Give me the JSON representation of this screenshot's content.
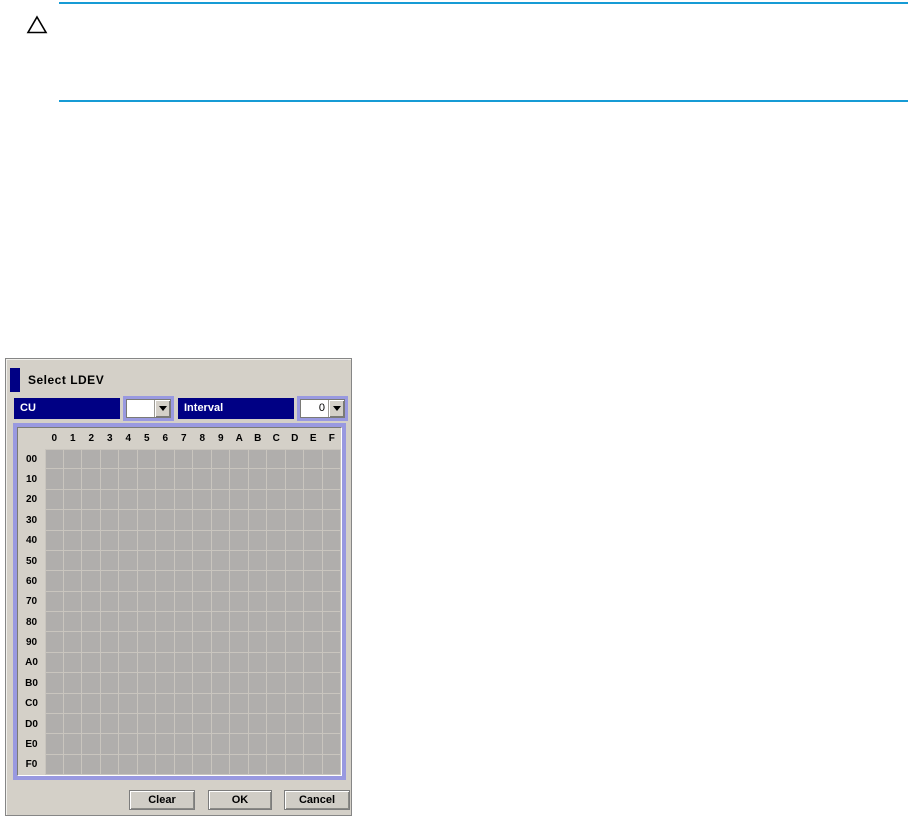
{
  "page": {
    "caution_icon": "warning-triangle",
    "rule_color": "#169bd5"
  },
  "dialog": {
    "title": "Select LDEV",
    "cu": {
      "label": "CU",
      "value": ""
    },
    "interval": {
      "label": "Interval",
      "value": "0"
    },
    "grid": {
      "column_headers": [
        "0",
        "1",
        "2",
        "3",
        "4",
        "5",
        "6",
        "7",
        "8",
        "9",
        "A",
        "B",
        "C",
        "D",
        "E",
        "F"
      ],
      "row_headers": [
        "00",
        "10",
        "20",
        "30",
        "40",
        "50",
        "60",
        "70",
        "80",
        "90",
        "A0",
        "B0",
        "C0",
        "D0",
        "E0",
        "F0"
      ]
    },
    "buttons": {
      "clear": "Clear",
      "ok": "OK",
      "cancel": "Cancel"
    },
    "colors": {
      "accent_navy": "#000084",
      "panel_border_lavender": "#9999e0",
      "cell_gray": "#b0aeac",
      "dialog_background": "#d4d0c8",
      "rule_cyan": "#169bd5"
    }
  }
}
